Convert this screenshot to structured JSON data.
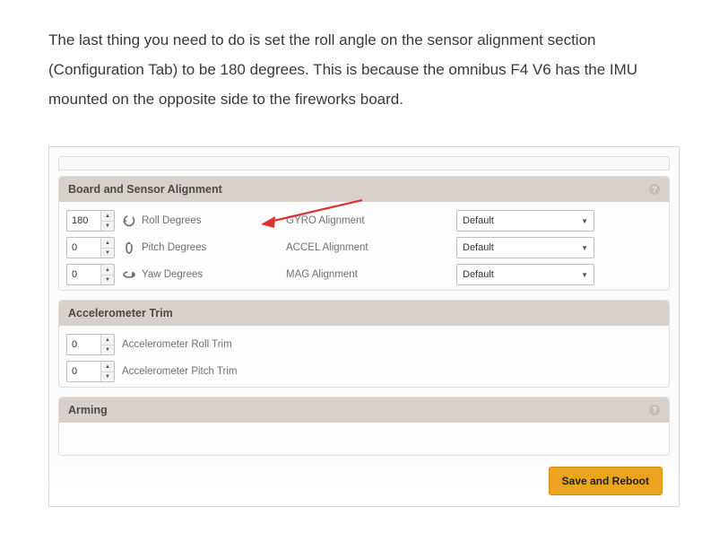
{
  "intro": "The last thing you need to do is set the roll angle on the sensor alignment section (Configuration Tab) to be 180 degrees.  This is because the omnibus F4 V6 has the IMU mounted on the opposite side to the fireworks board.",
  "panels": {
    "alignment": {
      "title": "Board and Sensor Alignment",
      "rows": [
        {
          "value": "180",
          "label": "Roll Degrees",
          "mid": "GYRO Alignment",
          "select": "Default"
        },
        {
          "value": "0",
          "label": "Pitch Degrees",
          "mid": "ACCEL Alignment",
          "select": "Default"
        },
        {
          "value": "0",
          "label": "Yaw Degrees",
          "mid": "MAG Alignment",
          "select": "Default"
        }
      ]
    },
    "trim": {
      "title": "Accelerometer Trim",
      "rows": [
        {
          "value": "0",
          "label": "Accelerometer Roll Trim"
        },
        {
          "value": "0",
          "label": "Accelerometer Pitch Trim"
        }
      ]
    },
    "arming": {
      "title": "Arming"
    }
  },
  "save_label": "Save and Reboot"
}
